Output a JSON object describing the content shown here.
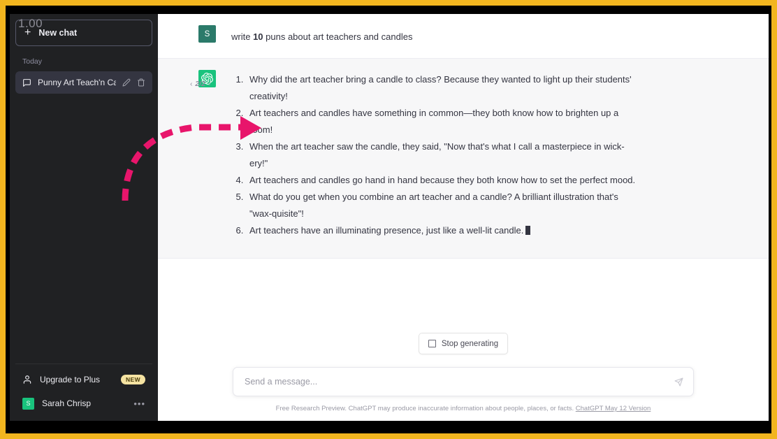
{
  "frame": {
    "border_color": "#F2B51F",
    "stage_color": "#000000"
  },
  "overlay": {
    "counter": "1.00"
  },
  "sidebar": {
    "new_chat_label": "New chat",
    "new_chat_icon": "plus-icon",
    "section_label": "Today",
    "chats": [
      {
        "title": "Punny Art Teach'n Can",
        "icon": "chat-bubble-icon",
        "edit_icon": "pencil-icon",
        "delete_icon": "trash-icon"
      }
    ],
    "upgrade": {
      "label": "Upgrade to Plus",
      "icon": "person-icon",
      "badge": "NEW",
      "badge_bg": "#f5e3a2"
    },
    "account": {
      "name": "Sarah Chrisp",
      "avatar_letter": "S",
      "avatar_bg": "#19c37d",
      "menu_icon": "ellipsis-icon"
    },
    "bg_color": "#202123"
  },
  "conversation": {
    "user_message": {
      "avatar_letter": "S",
      "avatar_bg": "#2b7a6a",
      "text_before": "write ",
      "text_bold": "10",
      "text_after": " puns about art teachers and candles"
    },
    "assistant_message": {
      "avatar_icon": "openai-logo-icon",
      "avatar_bg": "#19c37d",
      "pager": {
        "prev_icon": "chevron-left-icon",
        "label": "2/2",
        "next_icon": "chevron-right-icon"
      },
      "items": [
        "Why did the art teacher bring a candle to class? Because they wanted to light up their students' creativity!",
        "Art teachers and candles have something in common—they both know how to brighten up a room!",
        "When the art teacher saw the candle, they said, \"Now that's what I call a masterpiece in wick-ery!\"",
        "Art teachers and candles go hand in hand because they both know how to set the perfect mood.",
        "What do you get when you combine an art teacher and a candle? A brilliant illustration that's \"wax-quisite\"!",
        "Art teachers have an illuminating presence, just like a well-lit candle."
      ],
      "is_generating": true
    }
  },
  "composer": {
    "stop_button_label": "Stop generating",
    "stop_button_icon": "stop-square-icon",
    "input_placeholder": "Send a message...",
    "input_value": "",
    "send_icon": "send-icon"
  },
  "footer": {
    "disclaimer": "Free Research Preview. ChatGPT may produce inaccurate information about people, places, or facts. ",
    "version_link": "ChatGPT May 12 Version"
  },
  "annotation": {
    "arrow_color": "#E8156B",
    "style": "dashed-curved-arrow",
    "points_to": "list-item-2"
  }
}
